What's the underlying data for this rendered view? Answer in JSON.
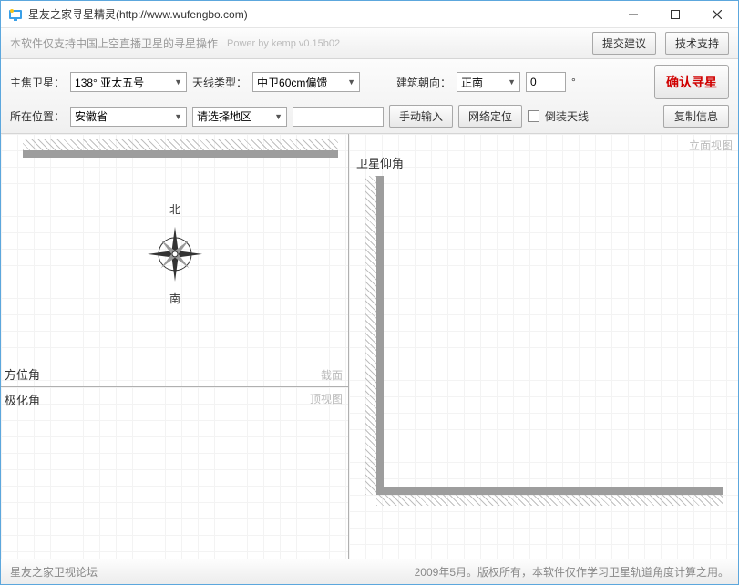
{
  "window": {
    "title": "星友之家寻星精灵(http://www.wufengbo.com)"
  },
  "infobar": {
    "hint": "本软件仅支持中国上空直播卫星的寻星操作",
    "powered": "Power by kemp  v0.15b02",
    "suggest_btn": "提交建议",
    "support_btn": "技术支持"
  },
  "form": {
    "satellite_label": "主焦卫星：",
    "satellite_value": "138°   亚太五号",
    "antenna_label": "天线类型：",
    "antenna_value": "中卫60cm偏馈",
    "orientation_label": "建筑朝向：",
    "orientation_value": "正南",
    "angle_value": "0",
    "degree_mark": "°",
    "confirm_btn": "确认寻星",
    "location_label": "所在位置：",
    "province_value": "安徽省",
    "district_value": "请选择地区",
    "manual_btn": "手动输入",
    "gps_btn": "网络定位",
    "invert_label": "倒装天线",
    "copy_btn": "复制信息"
  },
  "panes": {
    "azimuth": "方位角",
    "section_tag": "截面",
    "polarization": "极化角",
    "topview_tag": "顶视图",
    "elevation": "卫星仰角",
    "sideview_tag": "立面视图",
    "compass_n": "北",
    "compass_s": "南"
  },
  "footer": {
    "link": "星友之家卫视论坛",
    "copyright": "2009年5月。版权所有，本软件仅作学习卫星轨道角度计算之用。"
  }
}
